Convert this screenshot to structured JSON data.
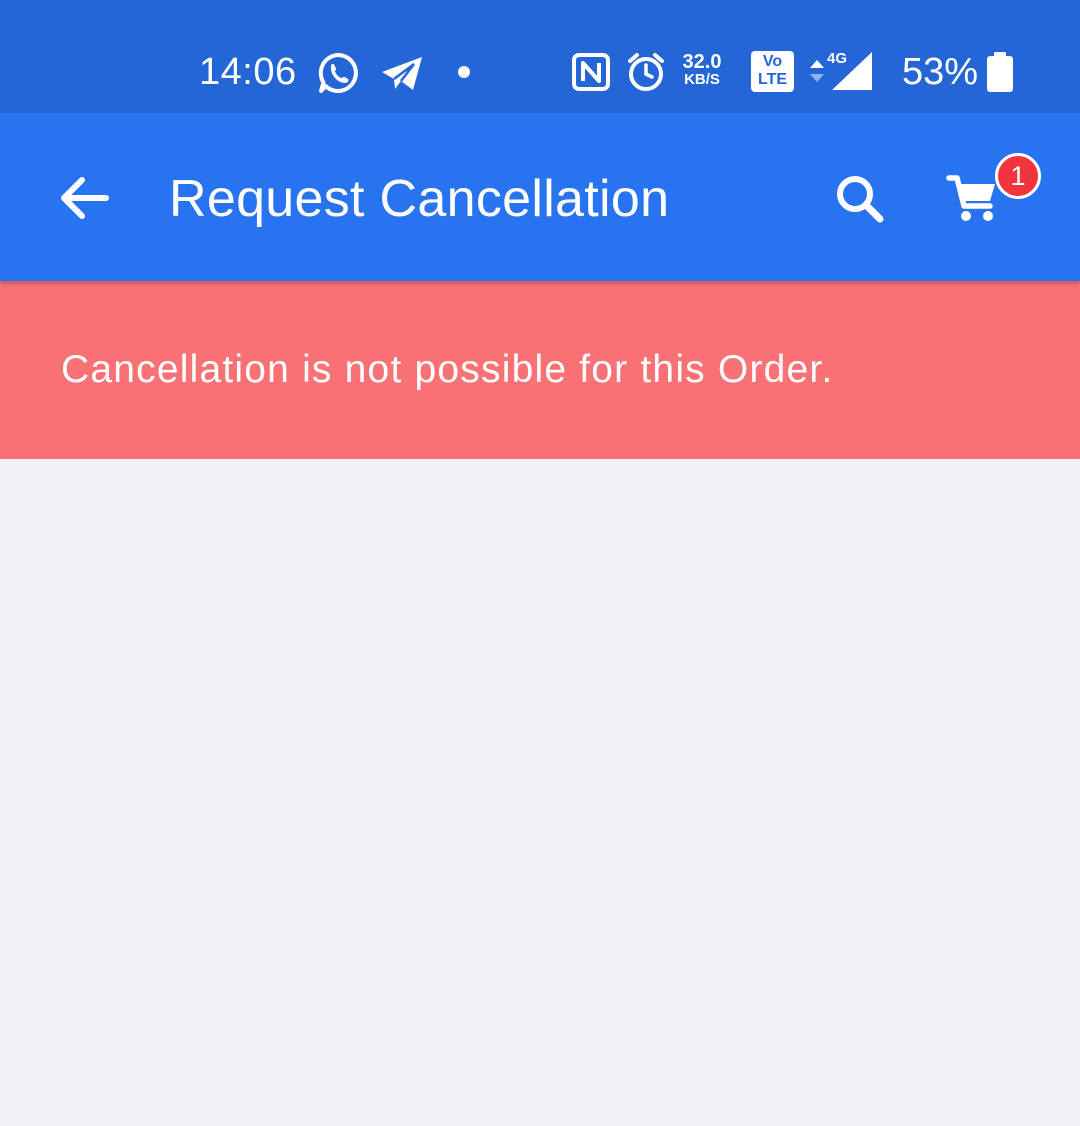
{
  "status_bar": {
    "time": "14:06",
    "net_speed_value": "32.0",
    "net_speed_unit": "KB/S",
    "volte_top": "Vo",
    "volte_bottom": "LTE",
    "network_type": "4G",
    "battery_percent": "53%",
    "battery_level": 0.53,
    "icons": [
      "whatsapp-icon",
      "telegram-icon",
      "notification-dot-icon",
      "nfc-icon",
      "alarm-icon",
      "signal-icon",
      "battery-icon"
    ]
  },
  "app_bar": {
    "title": "Request Cancellation",
    "cart_count": "1",
    "background": "#2874f0"
  },
  "alert": {
    "message": "Cancellation is not possible for this Order.",
    "background": "#f87174"
  },
  "colors": {
    "status_bar": "#2466d6",
    "page_background": "#f1f2f6",
    "badge": "#f0353d"
  }
}
